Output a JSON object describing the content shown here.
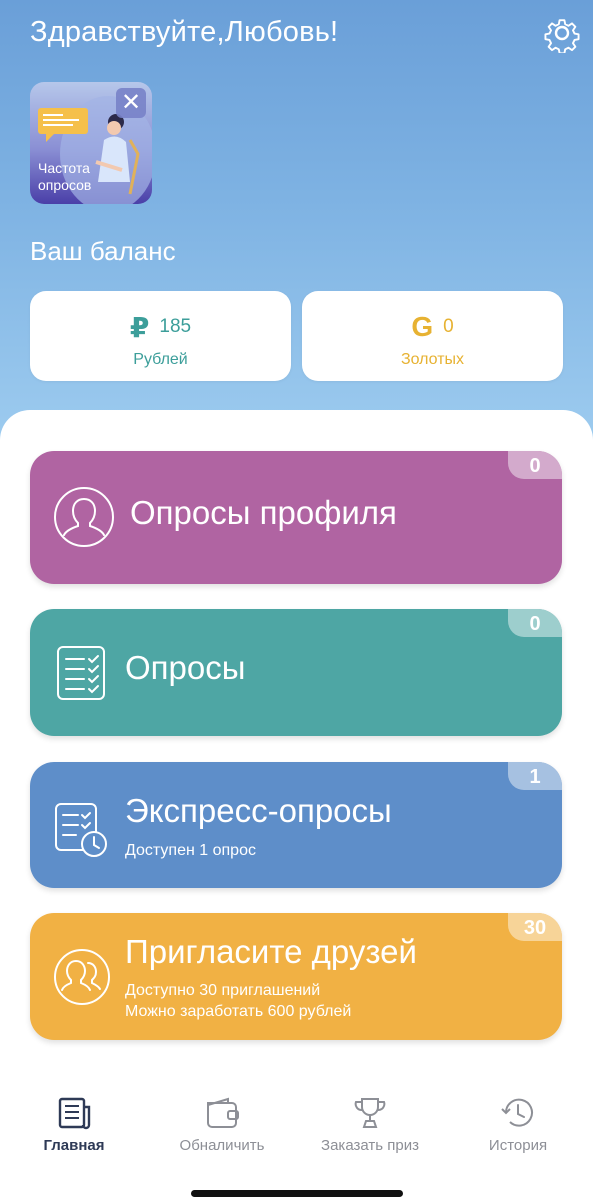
{
  "header": {
    "greeting": "Здравствуйте,Любовь!",
    "settings_icon": "gear-icon"
  },
  "story": {
    "label": "Частота опросов",
    "close_symbol": "✕"
  },
  "balance": {
    "title": "Ваш баланс",
    "rubles": {
      "symbol": "₽",
      "value": "185",
      "label": "Рублей",
      "color": "#3c9e9a"
    },
    "gold": {
      "symbol": "G",
      "value": "0",
      "label": "Золотых",
      "color": "#e7b232"
    }
  },
  "tiles": [
    {
      "title": "Опросы профиля",
      "badge": "0",
      "icon": "profile-icon",
      "color": "#b064a2"
    },
    {
      "title": "Опросы",
      "badge": "0",
      "icon": "checklist-icon",
      "color": "#4ea6a4"
    },
    {
      "title": "Экспресс-опросы",
      "subtitle": "Доступен 1 опрос",
      "badge": "1",
      "icon": "checklist-clock-icon",
      "color": "#5e8ec9"
    },
    {
      "title": "Пригласите друзей",
      "subtitle_1": "Доступно 30 приглашений",
      "subtitle_2": "Можно заработать 600 рублей",
      "badge": "30",
      "icon": "friends-icon",
      "color": "#f1b144"
    }
  ],
  "nav": {
    "items": [
      {
        "label": "Главная",
        "icon": "home-newspaper-icon",
        "active": true
      },
      {
        "label": "Обналичить",
        "icon": "wallet-icon",
        "active": false
      },
      {
        "label": "Заказать приз",
        "icon": "trophy-icon",
        "active": false
      },
      {
        "label": "История",
        "icon": "history-icon",
        "active": false
      }
    ]
  }
}
